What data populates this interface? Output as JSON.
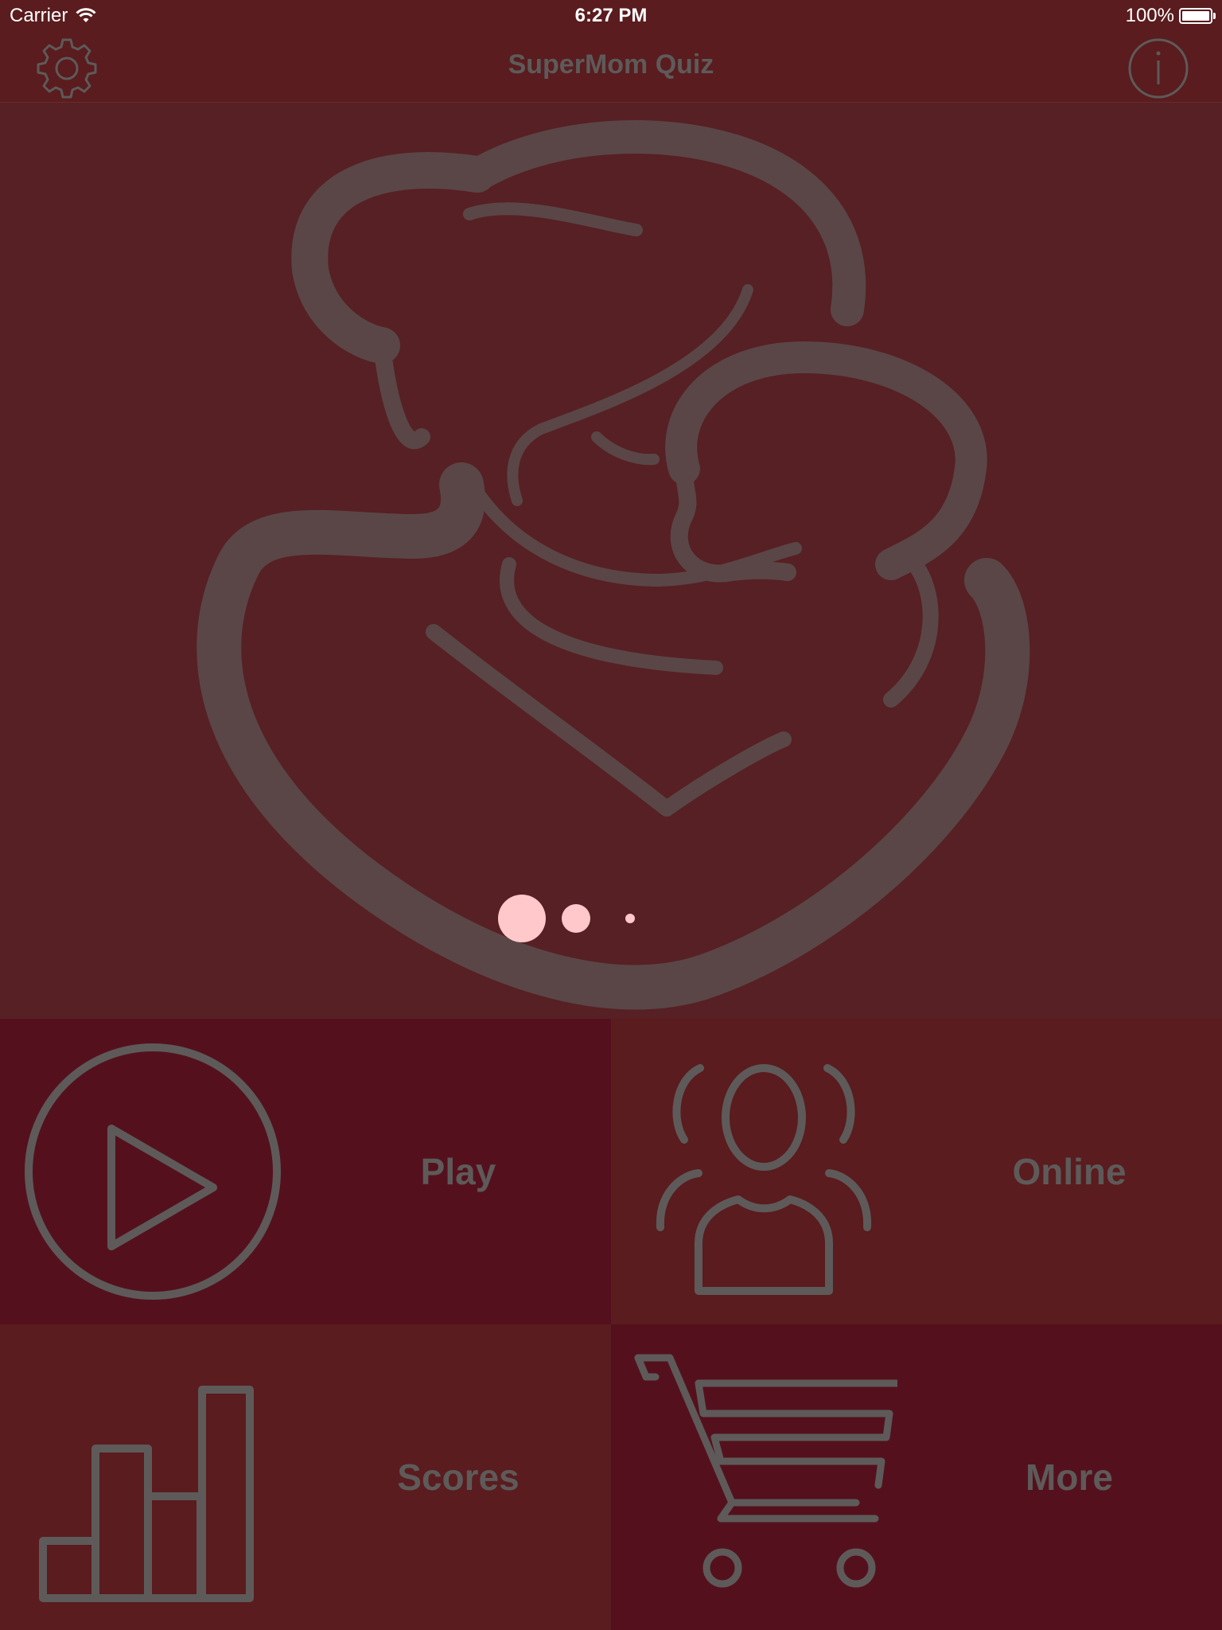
{
  "status_bar": {
    "carrier": "Carrier",
    "time": "6:27 PM",
    "battery": "100%"
  },
  "nav": {
    "title": "SuperMom Quiz",
    "left_icon": "gear-icon",
    "right_icon": "info-icon"
  },
  "hero": {
    "image": "mother-child-embrace-illustration",
    "loading_indicator": "page-dots-indicator"
  },
  "menu": {
    "play_label": "Play",
    "online_label": "Online",
    "scores_label": "Scores",
    "more_label": "More"
  },
  "colors": {
    "background": "#5a1c1e",
    "tile_dark": "#54111d",
    "hero_bg": "#572024",
    "icon_gray": "#5e5a5a",
    "dot_pink": "#ffc9cb"
  }
}
